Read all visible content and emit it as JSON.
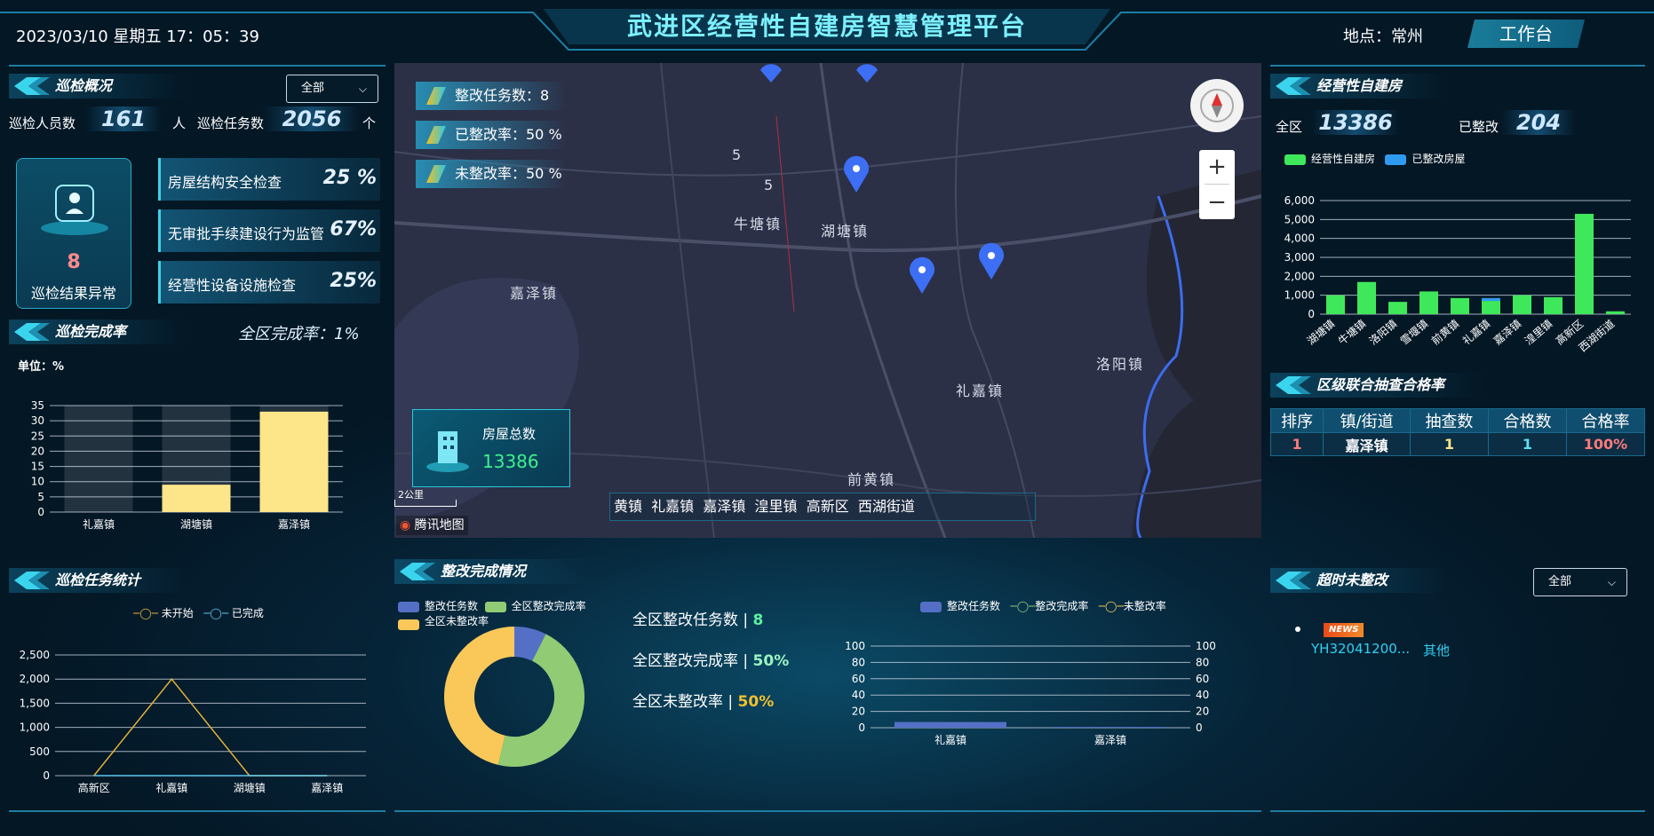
{
  "header": {
    "clock": "2023/03/10 星期五 17：05：39",
    "title": "武进区经营性自建房智慧管理平台",
    "location_label": "地点：",
    "location_value": "常州",
    "workbench_label": "工作台"
  },
  "inspection_overview": {
    "title": "巡检概况",
    "filter_value": "全部",
    "staff_label": "巡检人员数",
    "staff_count": "161",
    "staff_unit": "人",
    "task_label": "巡检任务数",
    "task_count": "2056",
    "task_unit": "个",
    "anomaly_count": "8",
    "anomaly_label": "巡检结果异常",
    "tasks": [
      {
        "label": "房屋结构安全检查",
        "percent": "25 %"
      },
      {
        "label": "无审批手续建设行为监管",
        "percent": "67%"
      },
      {
        "label": "经营性设备设施检查",
        "percent": "25%"
      }
    ]
  },
  "completion_rate": {
    "title": "巡检完成率",
    "district_rate": "全区完成率：1%",
    "unit": "单位：%"
  },
  "task_stats": {
    "title": "巡检任务统计",
    "legend": [
      "未开始",
      "已完成"
    ]
  },
  "rectification": {
    "title": "整改完成情况",
    "legend_donut": [
      "整改任务数",
      "全区整改完成率",
      "全区未整改率"
    ],
    "total_tasks_label": "全区整改任务数 | ",
    "total_tasks_value": "8",
    "done_rate_label": "全区整改完成率 | ",
    "done_rate_value": "50%",
    "undone_rate_label": "全区未整改率 | ",
    "undone_rate_value": "50%",
    "legend_bar": [
      "整改任务数",
      "整改完成率",
      "未整改率"
    ]
  },
  "map": {
    "stats": [
      {
        "label": "整改任务数：8"
      },
      {
        "label": "已整改率：50 %"
      },
      {
        "label": "未整改率：50 %"
      }
    ],
    "places": [
      "牛塘镇",
      "湖塘镇",
      "嘉泽镇",
      "洛阳镇",
      "礼嘉镇",
      "前黄镇"
    ],
    "numbers": [
      "5",
      "5"
    ],
    "house_total_label": "房屋总数",
    "house_total_value": "13386",
    "scale_label": "2公里",
    "brand": "腾讯地图",
    "ticker": "黄镇  礼嘉镇  嘉泽镇  湟里镇  高新区  西湖街道",
    "zoom_in": "+",
    "zoom_out": "−"
  },
  "self_built": {
    "title": "经营性自建房",
    "district_label": "全区",
    "district_value": "13386",
    "rectified_label": "已整改",
    "rectified_value": "204",
    "legend": [
      "经营性自建房",
      "已整改房屋"
    ]
  },
  "joint_check": {
    "title": "区级联合抽查合格率",
    "headers": [
      "排序",
      "镇/街道",
      "抽查数",
      "合格数",
      "合格率"
    ],
    "rows": [
      [
        "1",
        "嘉泽镇",
        "1",
        "1",
        "100%"
      ]
    ]
  },
  "overdue": {
    "title": "超时未整改",
    "filter_value": "全部",
    "badge": "NEWS",
    "item_id": "YH32041200...",
    "item_type": "其他"
  },
  "colors": {
    "green": "#3ee85a",
    "blue": "#2e9bf0",
    "yellow": "#fde68a",
    "orange": "#e5b23a",
    "donut_blue": "#5470c6",
    "donut_green": "#91cc75",
    "donut_yellow": "#fac858"
  },
  "chart_data": [
    {
      "type": "bar",
      "title": "经营性自建房",
      "categories": [
        "湖塘镇",
        "牛塘镇",
        "洛阳镇",
        "雪堰镇",
        "前黄镇",
        "礼嘉镇",
        "嘉泽镇",
        "湟里镇",
        "高新区",
        "西湖街道"
      ],
      "series": [
        {
          "name": "经营性自建房",
          "values": [
            1000,
            1700,
            650,
            1200,
            850,
            700,
            1000,
            900,
            5300,
            150
          ]
        },
        {
          "name": "已整改房屋",
          "values": [
            0,
            0,
            0,
            0,
            0,
            150,
            0,
            0,
            0,
            0
          ]
        }
      ],
      "ylim": [
        0,
        6000
      ],
      "yticks": [
        "6,000",
        "5,000",
        "4,000",
        "3,000",
        "2,000",
        "1,000",
        "0"
      ],
      "stacked": true
    },
    {
      "type": "bar",
      "title": "巡检完成率",
      "categories": [
        "礼嘉镇",
        "湖塘镇",
        "嘉泽镇"
      ],
      "values": [
        0,
        9,
        33
      ],
      "ylim": [
        0,
        35
      ],
      "yticks": [
        "35",
        "30",
        "25",
        "20",
        "15",
        "10",
        "5",
        "0"
      ]
    },
    {
      "type": "line",
      "title": "巡检任务统计",
      "categories": [
        "高新区",
        "礼嘉镇",
        "湖塘镇",
        "嘉泽镇"
      ],
      "series": [
        {
          "name": "未开始",
          "values": [
            0,
            2000,
            0,
            0
          ]
        },
        {
          "name": "已完成",
          "values": [
            0,
            0,
            0,
            0
          ]
        }
      ],
      "ylim": [
        0,
        2500
      ],
      "yticks": [
        "2,500",
        "2,000",
        "1,500",
        "1,000",
        "500",
        "0"
      ]
    },
    {
      "type": "pie",
      "title": "整改完成情况",
      "series": [
        {
          "name": "整改任务数",
          "value": 8
        },
        {
          "name": "全区整改完成率",
          "value": 50
        },
        {
          "name": "全区未整改率",
          "value": 50
        }
      ]
    },
    {
      "type": "bar",
      "categories": [
        "礼嘉镇",
        "嘉泽镇"
      ],
      "series": [
        {
          "name": "整改任务数",
          "values": [
            7,
            1
          ]
        },
        {
          "name": "整改完成率",
          "values": [
            0,
            0
          ]
        },
        {
          "name": "未整改率",
          "values": [
            0,
            0
          ]
        }
      ],
      "ylim": [
        0,
        100
      ],
      "yticks": [
        "100",
        "80",
        "60",
        "40",
        "20",
        "0"
      ]
    }
  ]
}
